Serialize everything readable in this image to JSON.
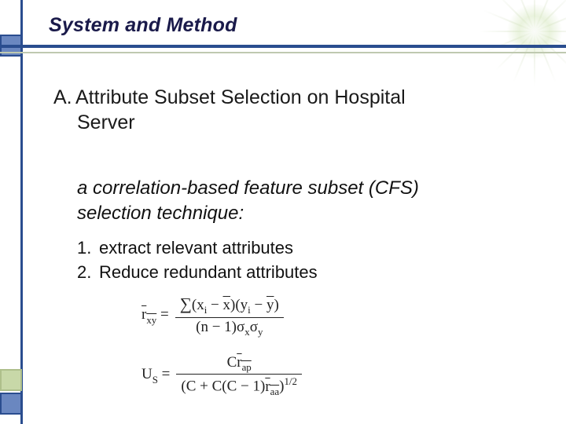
{
  "title": "System and Method",
  "section": {
    "marker": "A.",
    "heading_line1": "Attribute Subset Selection on Hospital",
    "heading_line2": "Server"
  },
  "subline_line1": "a correlation-based feature subset (CFS)",
  "subline_line2": "selection technique:",
  "list": {
    "items": [
      {
        "num": "1.",
        "text": "extract relevant attributes"
      },
      {
        "num": "2.",
        "text": "Reduce redundant attributes"
      }
    ]
  },
  "formulas": {
    "f1": {
      "lhs_base": "r",
      "lhs_sub": "xy",
      "eq": "=",
      "numer_sum": "∑",
      "numer_open": "(",
      "numer_xi": "x",
      "numer_isub": "i",
      "numer_minus1": " − ",
      "numer_xbar": "x",
      "numer_close1": ")",
      "numer_open2": "(",
      "numer_yi": "y",
      "numer_isub2": "i",
      "numer_minus2": " − ",
      "numer_ybar": "y",
      "numer_close2": ")",
      "denom_open": "(",
      "denom_n": "n − 1",
      "denom_close": ")",
      "denom_sx": "σ",
      "denom_sx_sub": "x",
      "denom_sy": "σ",
      "denom_sy_sub": "y"
    },
    "f2": {
      "lhs_U": "U",
      "lhs_S": "S",
      "eq": "=",
      "numer_C": "C",
      "numer_r": "r",
      "numer_r_sub": "ap",
      "denom_open": "(",
      "denom_C1": "C + C",
      "denom_open2": "(",
      "denom_Cm1": "C − 1",
      "denom_close2": ")",
      "denom_r": "r",
      "denom_r_sub": "aa",
      "denom_close": ")",
      "denom_exp": "1/2"
    }
  }
}
